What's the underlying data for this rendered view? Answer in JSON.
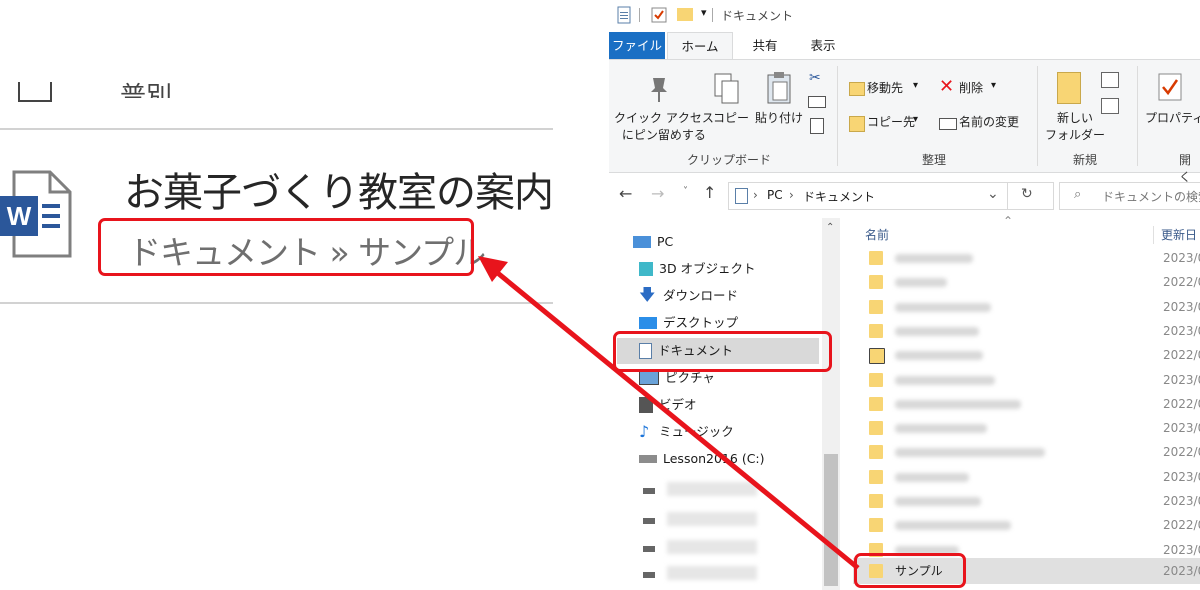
{
  "zoom_view": {
    "top_clipped_text": "普別",
    "document_title": "お菓子づくり教室の案内",
    "document_path": "ドキュメント » サンプル"
  },
  "explorer": {
    "window_title": "ドキュメント",
    "tabs": [
      {
        "label": "ファイル",
        "active": false
      },
      {
        "label": "ホーム",
        "active": true
      },
      {
        "label": "共有",
        "active": false
      },
      {
        "label": "表示",
        "active": false
      }
    ],
    "ribbon": {
      "pin_label_line1": "クイック アクセス",
      "pin_label_line2": "にピン留めする",
      "copy_label": "コピー",
      "paste_label": "貼り付け",
      "clipboard_group": "クリップボード",
      "move_to": "移動先",
      "copy_to": "コピー先",
      "delete": "削除",
      "rename": "名前の変更",
      "organize_group": "整理",
      "new_folder_line1": "新しい",
      "new_folder_line2": "フォルダー",
      "new_group": "新規",
      "properties": "プロパティ",
      "open_group": "開く"
    },
    "address": {
      "path_pc": "PC",
      "path_sep": "›",
      "path_docs": "ドキュメント",
      "search_placeholder": "ドキュメントの検索"
    },
    "nav_items": [
      {
        "label": "PC",
        "icon": "pc-icon"
      },
      {
        "label": "3D オブジェクト",
        "icon": "cube-icon"
      },
      {
        "label": "ダウンロード",
        "icon": "download-icon"
      },
      {
        "label": "デスクトップ",
        "icon": "desktop-icon"
      },
      {
        "label": "ドキュメント",
        "icon": "document-icon",
        "selected": true
      },
      {
        "label": "ピクチャ",
        "icon": "picture-icon"
      },
      {
        "label": "ビデオ",
        "icon": "video-icon"
      },
      {
        "label": "ミュージック",
        "icon": "music-icon"
      },
      {
        "label": "Lesson2016 (C:)",
        "icon": "drive-icon"
      }
    ],
    "columns": {
      "name": "名前",
      "modified": "更新日"
    },
    "files": [
      {
        "date": "2023/0"
      },
      {
        "date": "2022/0"
      },
      {
        "date": "2023/0"
      },
      {
        "date": "2023/0"
      },
      {
        "date": "2022/0"
      },
      {
        "date": "2023/0"
      },
      {
        "date": "2022/0"
      },
      {
        "date": "2023/0"
      },
      {
        "date": "2022/0"
      },
      {
        "date": "2023/0"
      },
      {
        "date": "2023/0"
      },
      {
        "date": "2022/0"
      },
      {
        "date": "2023/0"
      }
    ],
    "highlight_folder": {
      "name": "サンプル",
      "date": "2023/0"
    }
  },
  "colors": {
    "highlight": "#e8141c",
    "file_tab": "#1a6fc4",
    "folder": "#f8d574"
  }
}
